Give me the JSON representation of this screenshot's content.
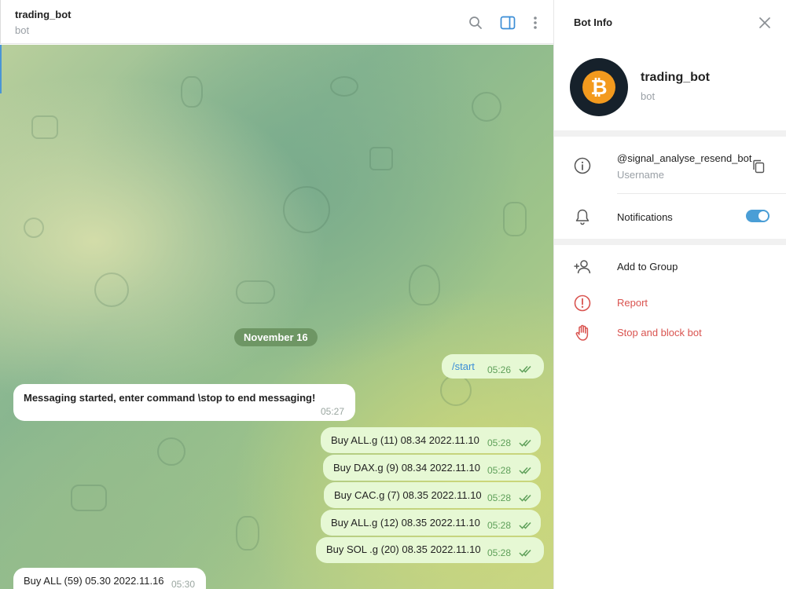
{
  "chat": {
    "title": "trading_bot",
    "subtitle": "bot",
    "date": "November 16",
    "messages": [
      {
        "text": "/start",
        "time": "05:26"
      },
      {
        "text": "Messaging started, enter command \\stop to end messaging!",
        "time": "05:27"
      },
      {
        "text": "Buy ALL.g (11) 08.34 2022.11.10",
        "time": "05:28"
      },
      {
        "text": "Buy DAX.g (9) 08.34 2022.11.10",
        "time": "05:28"
      },
      {
        "text": "Buy CAC.g (7) 08.35 2022.11.10",
        "time": "05:28"
      },
      {
        "text": "Buy ALL.g (12) 08.35 2022.11.10",
        "time": "05:28"
      },
      {
        "text": "Buy SOL .g (20) 08.35 2022.11.10",
        "time": "05:28"
      },
      {
        "text": "Buy ALL (59) 05.30 2022.11.16",
        "time": "05:30"
      }
    ]
  },
  "panel": {
    "title": "Bot Info",
    "name": "trading_bot",
    "sub": "bot",
    "username": "@signal_analyse_resend_bot",
    "username_label": "Username",
    "notifications_label": "Notifications",
    "add_to_group": "Add to Group",
    "report": "Report",
    "stop_block": "Stop and block bot"
  },
  "icons": {
    "search": "search-icon",
    "sidebar": "sidebar-toggle-icon",
    "more": "more-vertical-icon",
    "close": "close-icon",
    "info": "info-icon",
    "copy": "copy-icon",
    "bell": "bell-icon",
    "add_user": "add-user-icon",
    "report": "report-icon",
    "hand": "hand-stop-icon"
  },
  "colors": {
    "accent": "#4a9ed6",
    "danger": "#d9534f",
    "outgoing_bubble": "#e6f8d4",
    "bitcoin": "#f39a1e"
  }
}
